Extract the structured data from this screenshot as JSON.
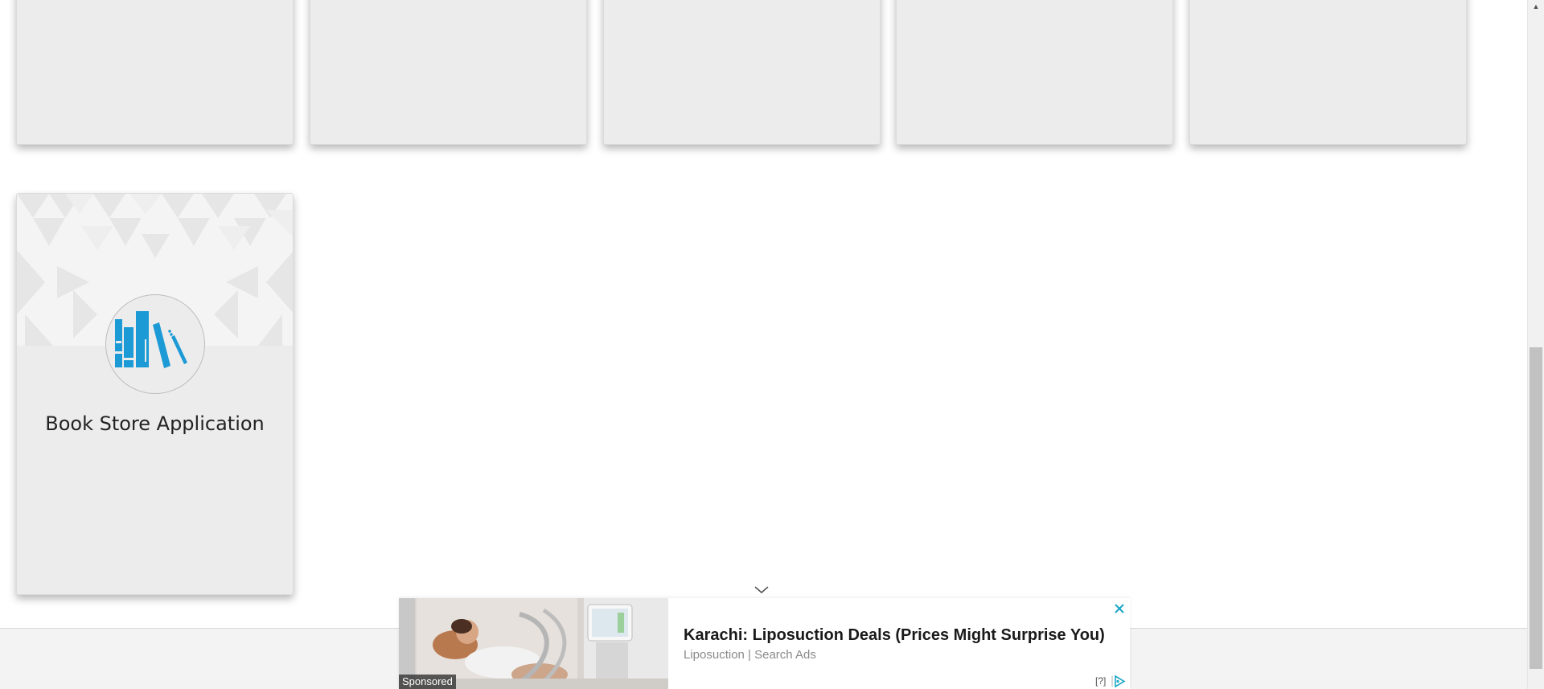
{
  "cards": {
    "book_store": {
      "title": "Book Store Application",
      "icon": "books-icon",
      "icon_color": "#1b9ad6"
    }
  },
  "ad": {
    "headline": "Karachi: Liposuction Deals (Prices Might Surprise You)",
    "source": "Liposuction | Search Ads",
    "sponsored_label": "Sponsored",
    "help_label": "[?]",
    "close_icon": "close-icon",
    "collapse_icon": "chevron-down-icon",
    "choices_icon": "adchoices-icon",
    "accent_color": "#1aa6c8"
  },
  "scrollbar": {
    "up_icon": "scroll-up-arrow-icon"
  }
}
